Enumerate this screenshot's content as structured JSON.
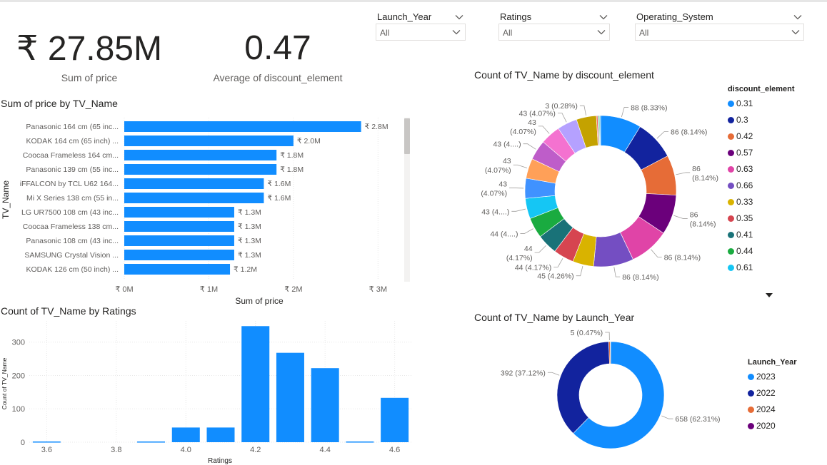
{
  "slicers": [
    {
      "title": "Launch_Year",
      "value": "All"
    },
    {
      "title": "Ratings",
      "value": "All"
    },
    {
      "title": "Operating_System",
      "value": "All"
    }
  ],
  "kpis": [
    {
      "value": "₹ 27.85M",
      "label": "Sum of price"
    },
    {
      "value": "0.47",
      "label": "Average of discount_element"
    }
  ],
  "colors": {
    "bar": "#118dff",
    "grid": "#e8e8e8",
    "label": "#605e5c",
    "scrollbar": "#c8c6c4"
  },
  "chart_data": [
    {
      "type": "bar",
      "orientation": "horizontal",
      "title": "Sum of price by TV_Name",
      "xlabel": "Sum of price",
      "ylabel": "TV_Name",
      "categories": [
        "Panasonic 164 cm (65 inc...",
        "KODAK 164 cm (65 inch) ...",
        "Coocaa Frameless 164 cm...",
        "Panasonic 139 cm (55 inc...",
        "iFFALCON by TCL U62 164...",
        "Mi X Series 138 cm (55 in...",
        "LG UR7500 108 cm (43 inc...",
        "Coocaa Frameless 138 cm...",
        "Panasonic 108 cm (43 inc...",
        "SAMSUNG Crystal Vision ...",
        "KODAK 126 cm (50 inch) ..."
      ],
      "values": [
        2800000,
        2000000,
        1800000,
        1800000,
        1650000,
        1650000,
        1300000,
        1300000,
        1300000,
        1300000,
        1250000
      ],
      "data_labels": [
        "₹ 2.8M",
        "₹ 2.0M",
        "₹ 1.8M",
        "₹ 1.8M",
        "₹ 1.6M",
        "₹ 1.6M",
        "₹ 1.3M",
        "₹ 1.3M",
        "₹ 1.3M",
        "₹ 1.3M",
        "₹ 1.2M"
      ],
      "xticks": [
        0,
        1000000,
        2000000,
        3000000
      ],
      "xtick_labels": [
        "₹ 0M",
        "₹ 1M",
        "₹ 2M",
        "₹ 3M"
      ],
      "xlim": [
        0,
        3200000
      ],
      "grid": true
    },
    {
      "type": "bar",
      "title": "Count of TV_Name by Ratings",
      "xlabel": "Ratings",
      "ylabel": "Count of TV_Name",
      "x": [
        3.6,
        3.9,
        4.0,
        4.1,
        4.2,
        4.3,
        4.4,
        4.5,
        4.6
      ],
      "values": [
        2,
        2,
        44,
        44,
        348,
        268,
        222,
        2,
        133
      ],
      "xticks": [
        3.6,
        3.8,
        4.0,
        4.2,
        4.4,
        4.6
      ],
      "xtick_labels": [
        "3.6",
        "3.8",
        "4.0",
        "4.2",
        "4.4",
        "4.6"
      ],
      "yticks": [
        0,
        100,
        200,
        300
      ],
      "xlim": [
        3.55,
        4.65
      ],
      "ylim": [
        0,
        355
      ],
      "grid": true
    },
    {
      "type": "pie",
      "donut": true,
      "title": "Count of TV_Name by discount_element",
      "legend_title": "discount_element",
      "legend_position": "right",
      "categories": [
        "0.31",
        "0.3",
        "0.42",
        "0.57",
        "0.63",
        "0.66",
        "0.33",
        "0.35",
        "0.41",
        "0.44",
        "0.61",
        "",
        "",
        "",
        "",
        "",
        "",
        "",
        "",
        "",
        ""
      ],
      "values": [
        88,
        86,
        86,
        86,
        86,
        86,
        45,
        44,
        44,
        44,
        44,
        43,
        43,
        43,
        43,
        43,
        43,
        3,
        2,
        2,
        2
      ],
      "slice_labels": [
        "88 (8.33%)",
        "86 (8.14%)",
        "86\n(8.14%)",
        "86\n(8.14%)",
        "86 (8.14%)",
        "86 (8.14%)",
        "45 (4.26%)",
        "44 (4.17%)",
        "44\n(4.17%)",
        "44 (4....)",
        "43 (4....)",
        "43\n(4.07%)",
        "43\n(4.07%)",
        "43 (4....)",
        "43\n(4.07%)",
        "43 (4.07%)",
        "3 (0.28%)",
        "",
        "",
        "",
        ""
      ],
      "colors": [
        "#118dff",
        "#12239e",
        "#e66c37",
        "#6b007b",
        "#e044a7",
        "#744ec2",
        "#d9b300",
        "#d64550",
        "#197278",
        "#1aab40",
        "#15c6f4",
        "#4092ff",
        "#ffa058",
        "#be5dc9",
        "#f472d0",
        "#b5a1ff",
        "#c4a200",
        "#fd625e",
        "#1a9e9e",
        "#4cbb6a",
        "#4fb9f3"
      ]
    },
    {
      "type": "pie",
      "donut": true,
      "title": "Count of TV_Name by Launch_Year",
      "legend_title": "Launch_Year",
      "legend_position": "right",
      "categories": [
        "2023",
        "2022",
        "2024",
        "2020"
      ],
      "values": [
        658,
        392,
        5,
        1
      ],
      "slice_labels": [
        "658 (62.31%)",
        "392 (37.12%)",
        "5 (0.47%)",
        ""
      ],
      "colors": [
        "#118dff",
        "#12239e",
        "#e66c37",
        "#6b007b"
      ]
    }
  ]
}
